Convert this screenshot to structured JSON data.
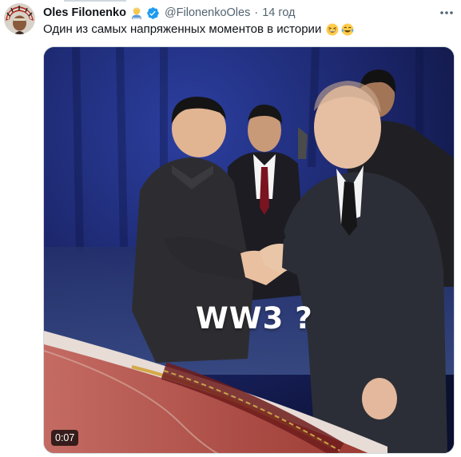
{
  "tweet": {
    "display_name": "Oles Filonenko",
    "handle": "@FilonenkoOles",
    "separator": "·",
    "time": "14 год",
    "text": "Один из самых напряженных моментов в истории",
    "emojis": [
      "grinning-squinting-face",
      "face-with-tears-of-joy"
    ],
    "verified_color": "#1d9bf0"
  },
  "media": {
    "caption": "WW3 ?",
    "duration": "0:07"
  }
}
